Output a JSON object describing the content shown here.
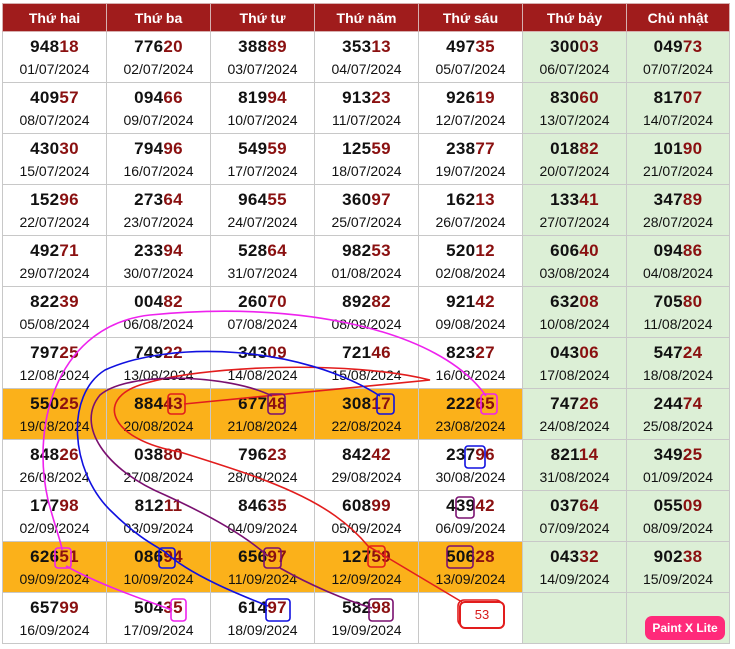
{
  "headers": [
    "Thứ hai",
    "Thứ ba",
    "Thứ tư",
    "Thứ năm",
    "Thứ sáu",
    "Thứ bảy",
    "Chủ nhật"
  ],
  "rows": [
    [
      {
        "n": "94818",
        "d": "01/07/2024"
      },
      {
        "n": "77620",
        "d": "02/07/2024"
      },
      {
        "n": "38889",
        "d": "03/07/2024"
      },
      {
        "n": "35313",
        "d": "04/07/2024"
      },
      {
        "n": "49735",
        "d": "05/07/2024"
      },
      {
        "n": "30003",
        "d": "06/07/2024"
      },
      {
        "n": "04973",
        "d": "07/07/2024"
      }
    ],
    [
      {
        "n": "40957",
        "d": "08/07/2024"
      },
      {
        "n": "09466",
        "d": "09/07/2024"
      },
      {
        "n": "81994",
        "d": "10/07/2024"
      },
      {
        "n": "91323",
        "d": "11/07/2024"
      },
      {
        "n": "92619",
        "d": "12/07/2024"
      },
      {
        "n": "83060",
        "d": "13/07/2024"
      },
      {
        "n": "81707",
        "d": "14/07/2024"
      }
    ],
    [
      {
        "n": "43030",
        "d": "15/07/2024"
      },
      {
        "n": "79496",
        "d": "16/07/2024"
      },
      {
        "n": "54959",
        "d": "17/07/2024"
      },
      {
        "n": "12559",
        "d": "18/07/2024"
      },
      {
        "n": "23877",
        "d": "19/07/2024"
      },
      {
        "n": "01882",
        "d": "20/07/2024"
      },
      {
        "n": "10190",
        "d": "21/07/2024"
      }
    ],
    [
      {
        "n": "15296",
        "d": "22/07/2024"
      },
      {
        "n": "27364",
        "d": "23/07/2024"
      },
      {
        "n": "96455",
        "d": "24/07/2024"
      },
      {
        "n": "36097",
        "d": "25/07/2024"
      },
      {
        "n": "16213",
        "d": "26/07/2024"
      },
      {
        "n": "13341",
        "d": "27/07/2024"
      },
      {
        "n": "34789",
        "d": "28/07/2024"
      }
    ],
    [
      {
        "n": "49271",
        "d": "29/07/2024"
      },
      {
        "n": "23394",
        "d": "30/07/2024"
      },
      {
        "n": "52864",
        "d": "31/07/2024"
      },
      {
        "n": "98253",
        "d": "01/08/2024"
      },
      {
        "n": "52012",
        "d": "02/08/2024"
      },
      {
        "n": "60640",
        "d": "03/08/2024"
      },
      {
        "n": "09486",
        "d": "04/08/2024"
      }
    ],
    [
      {
        "n": "82239",
        "d": "05/08/2024"
      },
      {
        "n": "00482",
        "d": "06/08/2024"
      },
      {
        "n": "26070",
        "d": "07/08/2024"
      },
      {
        "n": "89282",
        "d": "08/08/2024"
      },
      {
        "n": "92142",
        "d": "09/08/2024"
      },
      {
        "n": "63208",
        "d": "10/08/2024"
      },
      {
        "n": "70580",
        "d": "11/08/2024"
      }
    ],
    [
      {
        "n": "79725",
        "d": "12/08/2024"
      },
      {
        "n": "74922",
        "d": "13/08/2024"
      },
      {
        "n": "34309",
        "d": "14/08/2024"
      },
      {
        "n": "72146",
        "d": "15/08/2024"
      },
      {
        "n": "82327",
        "d": "16/08/2024"
      },
      {
        "n": "04306",
        "d": "17/08/2024"
      },
      {
        "n": "54724",
        "d": "18/08/2024"
      }
    ],
    [
      {
        "n": "55025",
        "d": "19/08/2024"
      },
      {
        "n": "88443",
        "d": "20/08/2024"
      },
      {
        "n": "67748",
        "d": "21/08/2024"
      },
      {
        "n": "30817",
        "d": "22/08/2024"
      },
      {
        "n": "22265",
        "d": "23/08/2024"
      },
      {
        "n": "74726",
        "d": "24/08/2024"
      },
      {
        "n": "24474",
        "d": "25/08/2024"
      }
    ],
    [
      {
        "n": "84826",
        "d": "26/08/2024"
      },
      {
        "n": "03880",
        "d": "27/08/2024"
      },
      {
        "n": "79623",
        "d": "28/08/2024"
      },
      {
        "n": "84242",
        "d": "29/08/2024"
      },
      {
        "n": "23796",
        "d": "30/08/2024"
      },
      {
        "n": "82114",
        "d": "31/08/2024"
      },
      {
        "n": "34925",
        "d": "01/09/2024"
      }
    ],
    [
      {
        "n": "17798",
        "d": "02/09/2024"
      },
      {
        "n": "81211",
        "d": "03/09/2024"
      },
      {
        "n": "84635",
        "d": "04/09/2024"
      },
      {
        "n": "60899",
        "d": "05/09/2024"
      },
      {
        "n": "43942",
        "d": "06/09/2024"
      },
      {
        "n": "03764",
        "d": "07/09/2024"
      },
      {
        "n": "05509",
        "d": "08/09/2024"
      }
    ],
    [
      {
        "n": "62651",
        "d": "09/09/2024"
      },
      {
        "n": "08694",
        "d": "10/09/2024"
      },
      {
        "n": "65697",
        "d": "11/09/2024"
      },
      {
        "n": "12759",
        "d": "12/09/2024"
      },
      {
        "n": "50628",
        "d": "13/09/2024"
      },
      {
        "n": "04332",
        "d": "14/09/2024"
      },
      {
        "n": "90238",
        "d": "15/09/2024"
      }
    ],
    [
      {
        "n": "65799",
        "d": "16/09/2024"
      },
      {
        "n": "50435",
        "d": "17/09/2024"
      },
      {
        "n": "61497",
        "d": "18/09/2024"
      },
      {
        "n": "58298",
        "d": "19/09/2024"
      },
      {
        "n": "",
        "d": ""
      },
      {
        "n": "",
        "d": ""
      },
      {
        "n": "",
        "d": ""
      }
    ]
  ],
  "highlighted_rows": [
    7,
    10
  ],
  "note_label": "53",
  "badge_label": "Paint X Lite",
  "colors": {
    "header_bg": "#a01c1c",
    "weekend_bg": "#dcefd6",
    "highlight_bg": "#fbb11a",
    "tail_digits": "#8a1010",
    "mark_red": "#e21d1d",
    "mark_blue": "#1010e0",
    "mark_purple": "#7a1070",
    "mark_magenta": "#ee22ee",
    "badge_bg": "#ff2a7a"
  }
}
